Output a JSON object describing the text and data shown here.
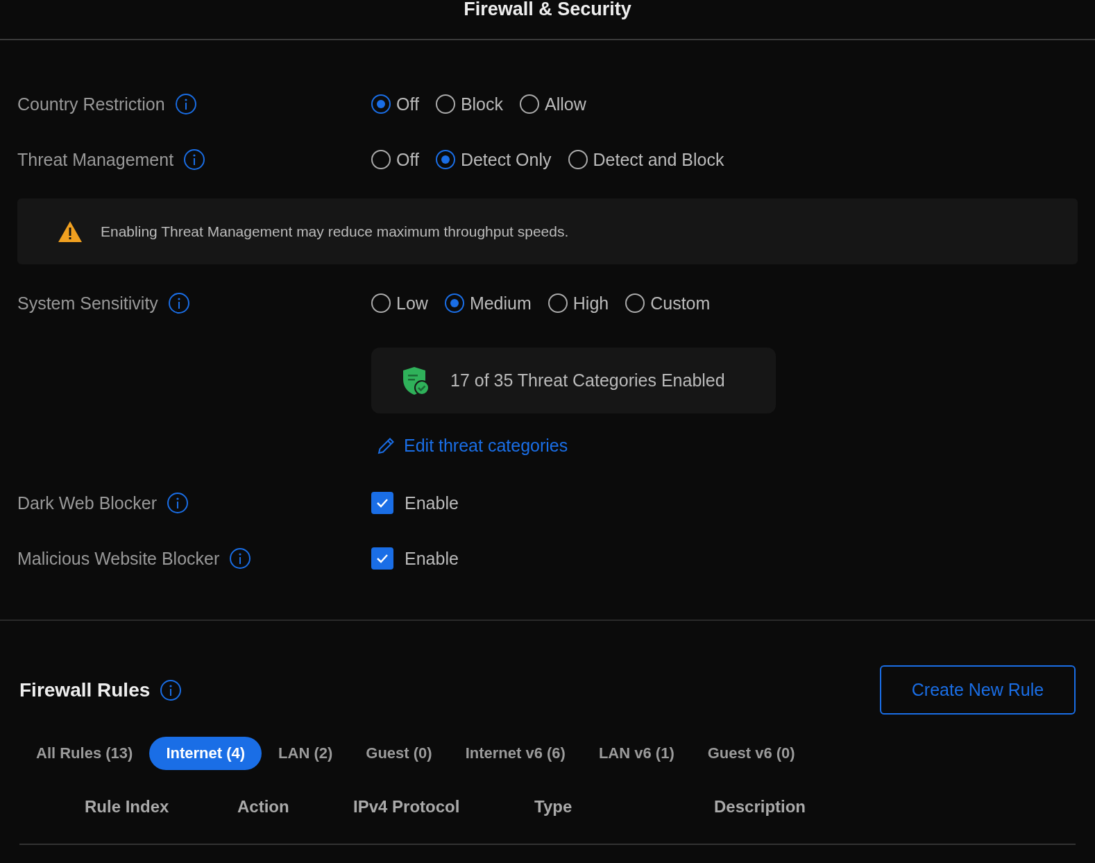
{
  "title": "Firewall & Security",
  "settings": [
    {
      "kind": "radio",
      "label": "Country Restriction",
      "options": [
        {
          "label": "Off",
          "selected": true
        },
        {
          "label": "Block",
          "selected": false
        },
        {
          "label": "Allow",
          "selected": false
        }
      ]
    },
    {
      "kind": "radio",
      "label": "Threat Management",
      "options": [
        {
          "label": "Off",
          "selected": false
        },
        {
          "label": "Detect Only",
          "selected": true
        },
        {
          "label": "Detect and Block",
          "selected": false
        }
      ]
    },
    {
      "kind": "notice",
      "text": "Enabling Threat Management may reduce maximum throughput speeds."
    },
    {
      "kind": "radio",
      "label": "System Sensitivity",
      "options": [
        {
          "label": "Low",
          "selected": false
        },
        {
          "label": "Medium",
          "selected": true
        },
        {
          "label": "High",
          "selected": false
        },
        {
          "label": "Custom",
          "selected": false
        }
      ]
    },
    {
      "kind": "summary",
      "text": "17 of 35 Threat Categories Enabled"
    },
    {
      "kind": "link",
      "text": "Edit threat categories"
    },
    {
      "kind": "checkbox",
      "label": "Dark Web Blocker",
      "option": "Enable",
      "checked": true
    },
    {
      "kind": "checkbox",
      "label": "Malicious Website Blocker",
      "option": "Enable",
      "checked": true
    }
  ],
  "firewall_rules": {
    "title": "Firewall Rules",
    "button": "Create New Rule",
    "tabs": [
      {
        "label": "All Rules (13)",
        "selected": false
      },
      {
        "label": "Internet (4)",
        "selected": true
      },
      {
        "label": "LAN (2)",
        "selected": false
      },
      {
        "label": "Guest (0)",
        "selected": false
      },
      {
        "label": "Internet v6 (6)",
        "selected": false
      },
      {
        "label": "LAN v6 (1)",
        "selected": false
      },
      {
        "label": "Guest v6 (0)",
        "selected": false
      }
    ],
    "columns": [
      "Rule Index",
      "Action",
      "IPv4 Protocol",
      "Type",
      "Description"
    ]
  }
}
